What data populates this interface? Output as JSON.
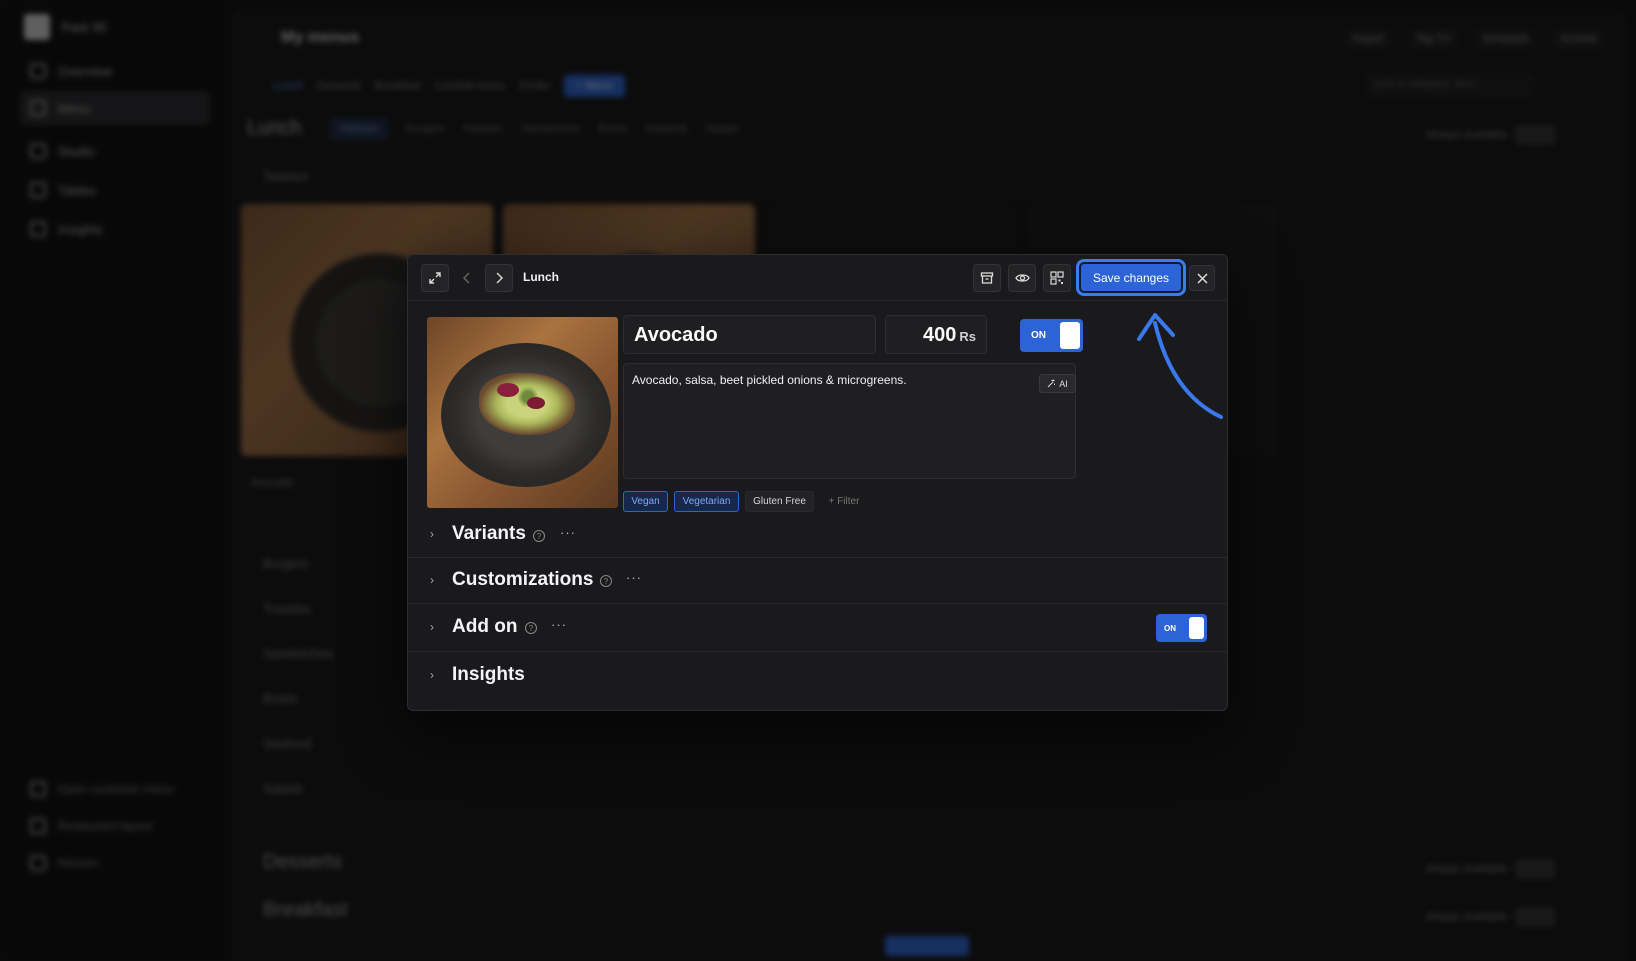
{
  "background": {
    "workspace": "Park 95",
    "sidebar": [
      "Overview",
      "Menu",
      "Studio",
      "Tables",
      "Insights"
    ],
    "sidebar_footer": [
      "Open customer menu",
      "Restaurant layout",
      "Kitchen"
    ],
    "page_title": "My menus",
    "top_actions": [
      "Import",
      "Tap TV",
      "Schedule",
      "Archive"
    ],
    "menu_tabs": [
      "Lunch",
      "Desserts",
      "Breakfast",
      "Cocktail menu",
      "Drinks",
      "+ Menu"
    ],
    "search_placeholder": "pick a category, item...",
    "section_title": "Lunch",
    "category_pills": [
      "Tartines",
      "Burgers",
      "Toasties",
      "Sandwiches",
      "Bowls",
      "Seafood",
      "Salads"
    ],
    "availability": "Always available",
    "categories": [
      "Tartines",
      "Burgers",
      "Toasties",
      "Sandwiches",
      "Bowls",
      "Seafood",
      "Salads"
    ],
    "card_label": "Avocado",
    "other_sections": [
      "Desserts",
      "Breakfast"
    ]
  },
  "modal": {
    "breadcrumb": "Lunch",
    "save_label": "Save changes",
    "item": {
      "name": "Avocado",
      "price": "400",
      "currency": "Rs",
      "available_toggle": "ON",
      "description": "Avocado, salsa, beet pickled onions & microgreens.",
      "ai_label": "AI"
    },
    "tags": [
      {
        "label": "Vegan",
        "selected": true
      },
      {
        "label": "Vegetarian",
        "selected": true
      },
      {
        "label": "Gluten Free",
        "selected": false
      }
    ],
    "filter_label": "+ Filter",
    "sections": [
      {
        "title": "Variants"
      },
      {
        "title": "Customizations"
      },
      {
        "title": "Add on",
        "toggle": "ON"
      },
      {
        "title": "Insights"
      }
    ],
    "help_glyph": "?",
    "more_glyph": "···"
  },
  "colors": {
    "accent": "#2c63d6",
    "modal_bg": "#1a1a1c",
    "page_bg": "#0d0d0e",
    "annotation_arrow": "#3a78ee"
  },
  "icons": [
    "expand-icon",
    "chevron-left-icon",
    "chevron-right-icon",
    "archive-icon",
    "eye-icon",
    "qr-code-icon",
    "close-icon",
    "sparkle-icon",
    "chevron-right-icon",
    "help-circle-icon",
    "more-horizontal-icon"
  ]
}
